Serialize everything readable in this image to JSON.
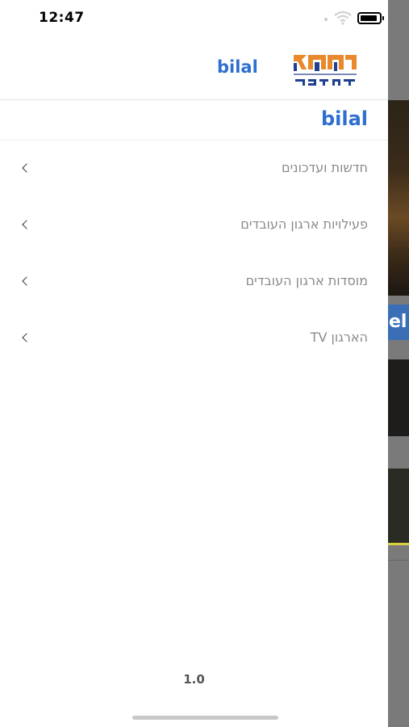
{
  "status_bar": {
    "time": "12:47"
  },
  "header": {
    "title": "bilal",
    "logo_alt": "מרחב צפון"
  },
  "drawer": {
    "user_name": "bilal",
    "menu_items": [
      {
        "label": "חדשות ועדכונים"
      },
      {
        "label": "פעילויות ארגון העובדים"
      },
      {
        "label": "מוסדות ארגון העובדים"
      },
      {
        "label": "הארגון TV"
      }
    ],
    "version": "1.0"
  },
  "background": {
    "banner_text": "el"
  },
  "colors": {
    "accent": "#2e6fd0",
    "menu_text": "#8a8a8a",
    "logo_orange": "#e8892b",
    "logo_blue": "#1f3f8f"
  }
}
